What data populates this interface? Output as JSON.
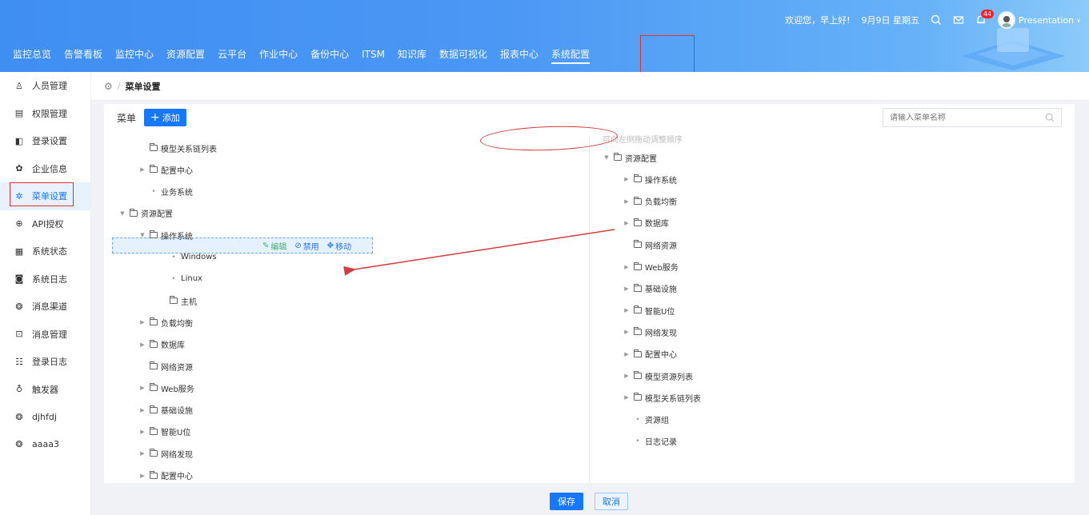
{
  "header": {
    "greeting": "欢迎您，早上好!",
    "date": "9月9日 星期五",
    "notification_count": "44",
    "user": "Presentation",
    "nav": [
      {
        "label": "监控总览"
      },
      {
        "label": "告警看板"
      },
      {
        "label": "监控中心"
      },
      {
        "label": "资源配置"
      },
      {
        "label": "云平台"
      },
      {
        "label": "作业中心"
      },
      {
        "label": "备份中心"
      },
      {
        "label": "ITSM"
      },
      {
        "label": "知识库"
      },
      {
        "label": "数据可视化"
      },
      {
        "label": "报表中心"
      },
      {
        "label": "系统配置"
      }
    ],
    "active_nav": "系统配置"
  },
  "sidebar": {
    "items": [
      {
        "label": "人员管理",
        "icon": "user-icon"
      },
      {
        "label": "权限管理",
        "icon": "permission-icon"
      },
      {
        "label": "登录设置",
        "icon": "login-settings-icon"
      },
      {
        "label": "企业信息",
        "icon": "enterprise-icon"
      },
      {
        "label": "菜单设置",
        "icon": "gear-icon"
      },
      {
        "label": "API授权",
        "icon": "api-icon"
      },
      {
        "label": "系统状态",
        "icon": "grid-icon"
      },
      {
        "label": "系统日志",
        "icon": "log-icon"
      },
      {
        "label": "消息渠道",
        "icon": "channel-icon"
      },
      {
        "label": "消息管理",
        "icon": "message-icon"
      },
      {
        "label": "登录日志",
        "icon": "login-log-icon"
      },
      {
        "label": "触发器",
        "icon": "trigger-icon"
      },
      {
        "label": "djhfdj",
        "icon": "plugin-icon"
      },
      {
        "label": "aaaa3",
        "icon": "plugin-icon"
      }
    ],
    "active": "菜单设置"
  },
  "breadcrumb": {
    "current": "菜单设置"
  },
  "panel": {
    "title": "菜单",
    "add_label": "添加",
    "search_placeholder": "请输入菜单名称",
    "left_tree": [
      {
        "label": "模型关系链列表",
        "type": "folder",
        "caret": false,
        "level": 1
      },
      {
        "label": "配置中心",
        "type": "folder",
        "caret": true,
        "level": 1
      },
      {
        "label": "业务系统",
        "type": "leaf",
        "caret": false,
        "level": 1
      },
      {
        "label": "资源配置",
        "type": "folder",
        "caret": "open",
        "level": 0,
        "selected": true
      },
      {
        "label": "操作系统",
        "type": "folder",
        "caret": "open",
        "level": 1
      },
      {
        "label": "Windows",
        "type": "leaf",
        "caret": false,
        "level": 2
      },
      {
        "label": "Linux",
        "type": "leaf",
        "caret": false,
        "level": 2
      },
      {
        "label": "主机",
        "type": "folder",
        "caret": false,
        "level": 2
      },
      {
        "label": "负载均衡",
        "type": "folder",
        "caret": true,
        "level": 1
      },
      {
        "label": "数据库",
        "type": "folder",
        "caret": true,
        "level": 1
      },
      {
        "label": "网络资源",
        "type": "folder",
        "caret": false,
        "level": 1
      },
      {
        "label": "Web服务",
        "type": "folder",
        "caret": true,
        "level": 1
      },
      {
        "label": "基础设施",
        "type": "folder",
        "caret": true,
        "level": 1
      },
      {
        "label": "智能U位",
        "type": "folder",
        "caret": true,
        "level": 1
      },
      {
        "label": "网络发现",
        "type": "folder",
        "caret": true,
        "level": 1
      },
      {
        "label": "配置中心",
        "type": "folder",
        "caret": true,
        "level": 1
      }
    ],
    "row_actions": {
      "edit": "编辑",
      "disable": "禁用",
      "move": "移动"
    },
    "right_hint": "可向左侧拖动调整顺序",
    "right_tree": [
      {
        "label": "资源配置",
        "type": "folder",
        "caret": "open",
        "level": 0
      },
      {
        "label": "操作系统",
        "type": "folder",
        "caret": true,
        "level": 1
      },
      {
        "label": "负载均衡",
        "type": "folder",
        "caret": true,
        "level": 1
      },
      {
        "label": "数据库",
        "type": "folder",
        "caret": true,
        "level": 1
      },
      {
        "label": "网络资源",
        "type": "folder",
        "caret": false,
        "level": 1
      },
      {
        "label": "Web服务",
        "type": "folder",
        "caret": true,
        "level": 1
      },
      {
        "label": "基础设施",
        "type": "folder",
        "caret": true,
        "level": 1
      },
      {
        "label": "智能U位",
        "type": "folder",
        "caret": true,
        "level": 1
      },
      {
        "label": "网络发现",
        "type": "folder",
        "caret": true,
        "level": 1
      },
      {
        "label": "配置中心",
        "type": "folder",
        "caret": true,
        "level": 1
      },
      {
        "label": "模型资源列表",
        "type": "folder",
        "caret": true,
        "level": 1
      },
      {
        "label": "模型关系链列表",
        "type": "folder",
        "caret": true,
        "level": 1
      },
      {
        "label": "资源组",
        "type": "leaf",
        "caret": false,
        "level": 1
      },
      {
        "label": "日志记录",
        "type": "leaf",
        "caret": false,
        "level": 1
      }
    ]
  },
  "footer": {
    "save": "保存",
    "cancel": "取消"
  },
  "colors": {
    "primary": "#1677ff",
    "annotation": "#e03030",
    "edit": "#3bb36a"
  }
}
